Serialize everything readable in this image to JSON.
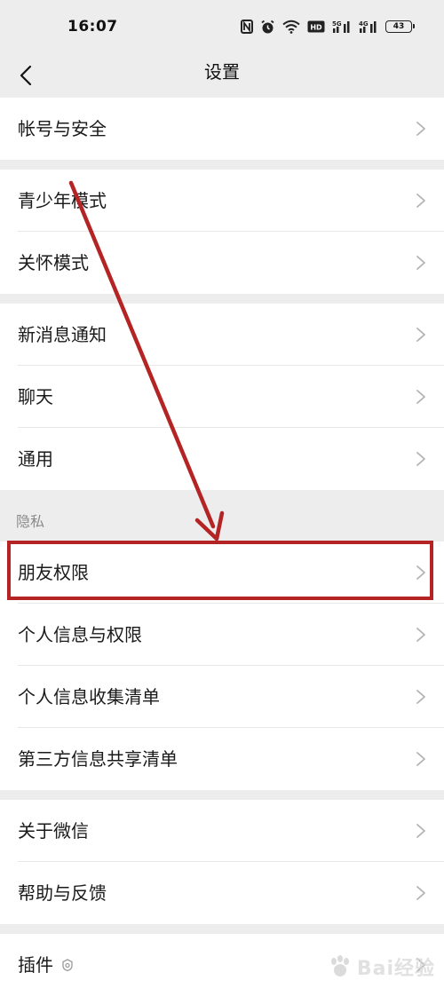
{
  "status_bar": {
    "time": "16:07",
    "battery": "43",
    "signal_5g": "5G",
    "signal_4g": "4G",
    "hd_label": "HD"
  },
  "nav": {
    "title": "设置"
  },
  "groups": [
    {
      "items": [
        {
          "label": "帐号与安全"
        }
      ]
    },
    {
      "items": [
        {
          "label": "青少年模式"
        },
        {
          "label": "关怀模式"
        }
      ]
    },
    {
      "items": [
        {
          "label": "新消息通知"
        },
        {
          "label": "聊天"
        },
        {
          "label": "通用"
        }
      ]
    },
    {
      "header": "隐私",
      "items": [
        {
          "label": "朋友权限"
        },
        {
          "label": "个人信息与权限"
        },
        {
          "label": "个人信息收集清单"
        },
        {
          "label": "第三方信息共享清单"
        }
      ]
    },
    {
      "items": [
        {
          "label": "关于微信"
        },
        {
          "label": "帮助与反馈"
        }
      ]
    },
    {
      "items": [
        {
          "label": "插件"
        }
      ]
    }
  ],
  "watermark": {
    "text": "Bai经验"
  },
  "colors": {
    "background": "#ededed",
    "annotation_red": "#b52424",
    "label_text": "#1a1a1a",
    "header_text": "#8a8a8a"
  }
}
